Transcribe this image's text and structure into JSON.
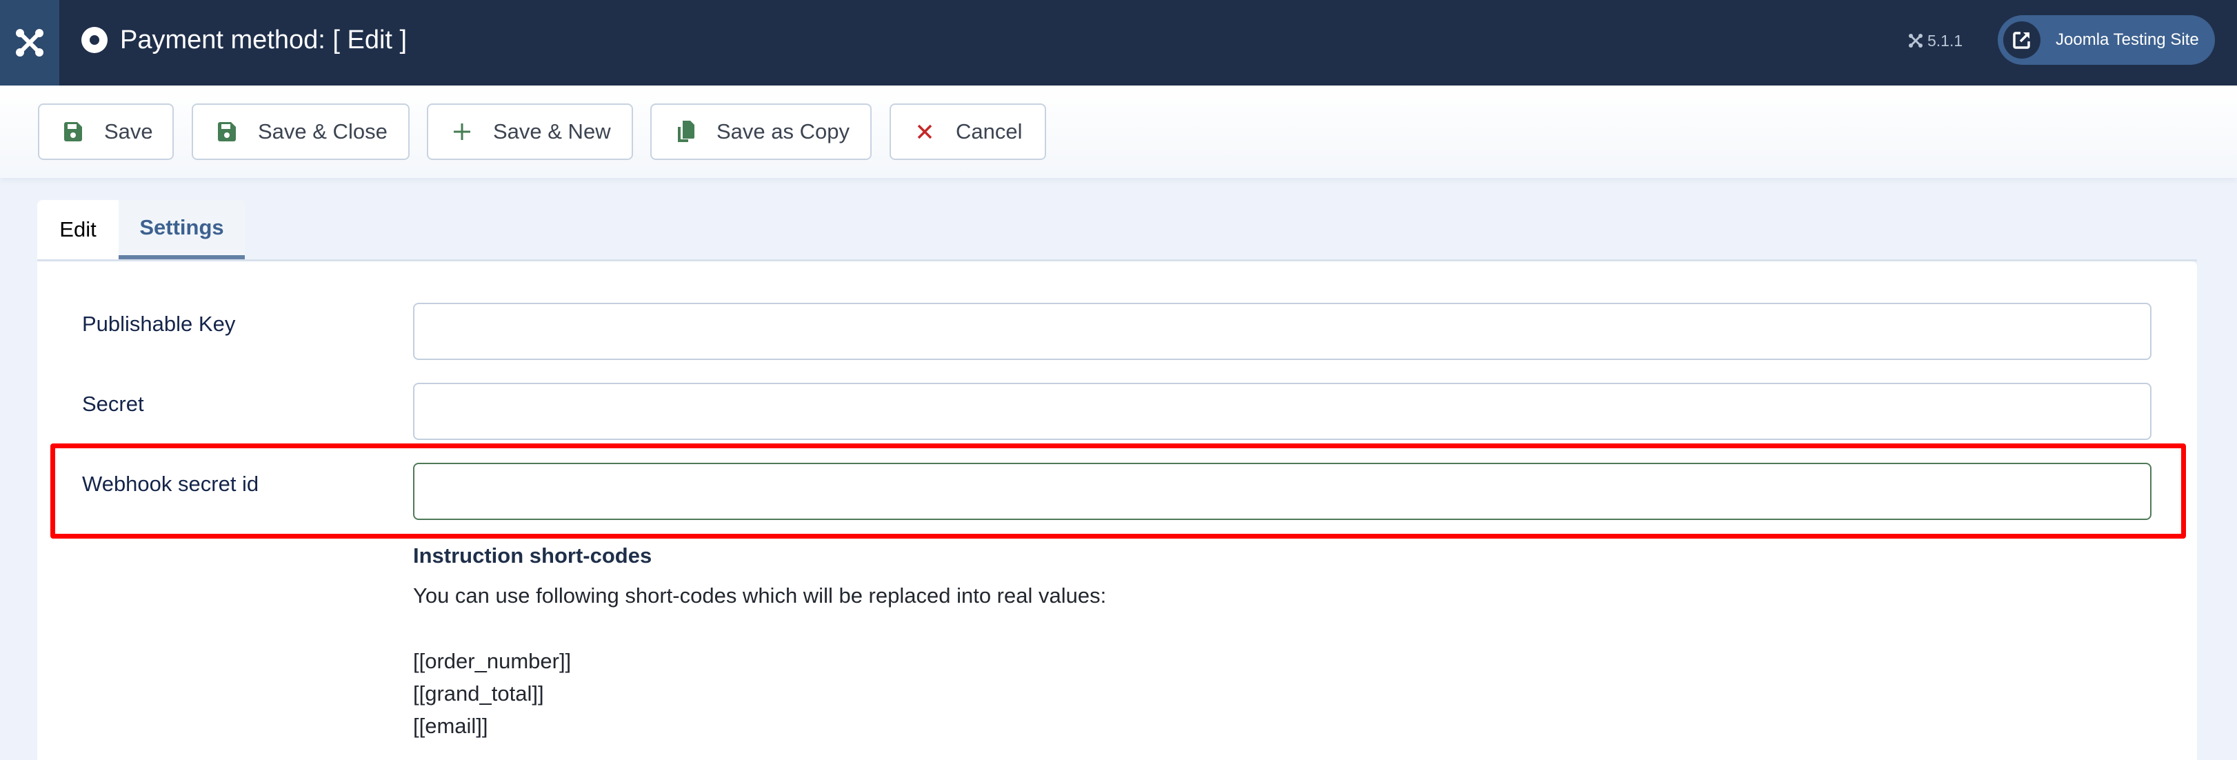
{
  "header": {
    "title": "Payment method: [ Edit ]",
    "version": "5.1.1",
    "site_button_label": "Joomla Testing Site",
    "icons": {
      "logo": "joomla-logo-icon",
      "title_icon": "circle-dot-icon",
      "version_icon": "joomla-small-icon",
      "site_icon": "external-link-icon"
    }
  },
  "toolbar": {
    "buttons": [
      {
        "label": "Save",
        "icon": "save-icon",
        "icon_color": "#457d54"
      },
      {
        "label": "Save & Close",
        "icon": "save-icon",
        "icon_color": "#457d54"
      },
      {
        "label": "Save & New",
        "icon": "plus-icon",
        "icon_color": "#457d54"
      },
      {
        "label": "Save as Copy",
        "icon": "copy-icon",
        "icon_color": "#457d54"
      },
      {
        "label": "Cancel",
        "icon": "close-icon",
        "icon_color": "#c52827"
      }
    ]
  },
  "tabs": [
    {
      "label": "Edit",
      "active": false
    },
    {
      "label": "Settings",
      "active": true
    }
  ],
  "form": {
    "fields": [
      {
        "label": "Publishable Key",
        "value": "",
        "placeholder": ""
      },
      {
        "label": "Secret",
        "value": "",
        "placeholder": ""
      },
      {
        "label": "Webhook secret id",
        "value": "",
        "placeholder": "",
        "focused": true
      }
    ]
  },
  "instructions": {
    "title": "Instruction short-codes",
    "description": "You can use following short-codes which will be replaced into real values:",
    "codes": [
      "[[order_number]]",
      "[[grand_total]]",
      "[[email]]"
    ]
  },
  "colors": {
    "header_bg": "#1f2f4a",
    "accent": "#3d6190",
    "highlight": "#ff0000",
    "success": "#457d54",
    "danger": "#c52827"
  }
}
